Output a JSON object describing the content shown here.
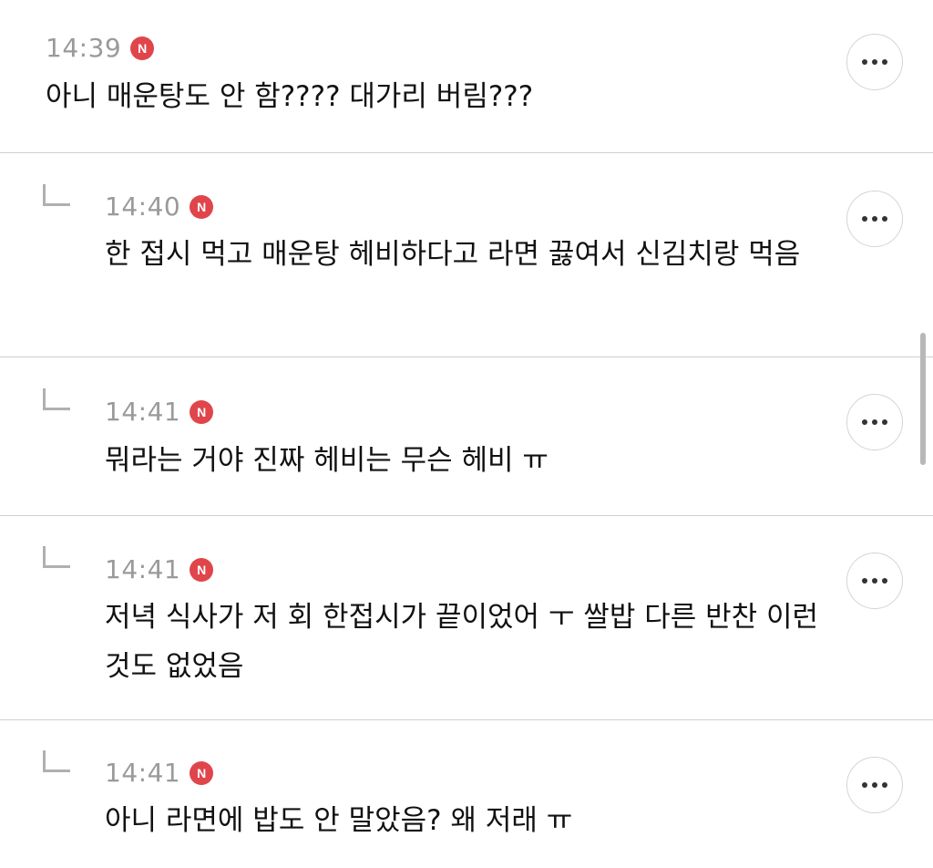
{
  "comments": [
    {
      "time": "14:39",
      "badge": "N",
      "text": "아니 매운탕도 안 함???? 대가리 버림???",
      "is_reply": false
    },
    {
      "time": "14:40",
      "badge": "N",
      "text": "한 접시 먹고 매운탕 헤비하다고 라면 끓여서 신김치랑 먹음",
      "is_reply": true
    },
    {
      "time": "14:41",
      "badge": "N",
      "text": "뭐라는 거야 진짜 헤비는 무슨 헤비 ㅠ",
      "is_reply": true
    },
    {
      "time": "14:41",
      "badge": "N",
      "text": "저녁 식사가 저 회 한접시가 끝이었어 ㅜ 쌀밥 다른 반찬 이런 것도 없었음",
      "is_reply": true
    },
    {
      "time": "14:41",
      "badge": "N",
      "text": "아니 라면에 밥도 안 말았음? 왜 저래 ㅠ",
      "is_reply": true
    }
  ],
  "icons": {
    "reply": "reply-arrow-icon",
    "new_badge": "new-badge-icon",
    "more": "more-horizontal-icon"
  },
  "colors": {
    "badge": "#e0454b",
    "time": "#9a9a9a",
    "divider": "#cfcfcf"
  }
}
